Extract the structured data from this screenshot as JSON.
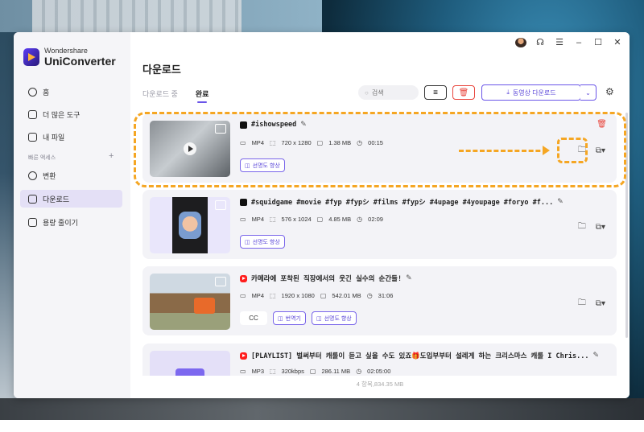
{
  "app": {
    "brand": "Wondershare",
    "product": "UniConverter"
  },
  "sidebar": {
    "items": [
      {
        "label": "홈",
        "icon": "home-icon"
      },
      {
        "label": "더 많은 도구",
        "icon": "toolbox-icon"
      },
      {
        "label": "내 파일",
        "icon": "file-icon"
      }
    ],
    "section_label": "빠른 액세스",
    "quick": [
      {
        "label": "변환",
        "icon": "convert-icon"
      },
      {
        "label": "다운로드",
        "icon": "download-icon",
        "active": true
      },
      {
        "label": "용량 줄이기",
        "icon": "compress-icon"
      }
    ]
  },
  "main": {
    "title": "다운로드",
    "tabs": [
      "다운로드 중",
      "완료"
    ],
    "active_tab": "완료",
    "search_placeholder": "검색",
    "download_button": "동영상 다운로드"
  },
  "downloads": [
    {
      "platform": "tiktok",
      "title": "#ishowspeed",
      "format": "MP4",
      "resolution": "720 x 1280",
      "size": "1.38 MB",
      "duration": "00:15",
      "chips": [
        "선명도 향상"
      ]
    },
    {
      "platform": "tiktok",
      "title": "#squidgame #movie #fyp #fypシ #films #fypシ #4upage #4youpage #foryo #f...",
      "format": "MP4",
      "resolution": "576 x 1024",
      "size": "4.85 MB",
      "duration": "02:09",
      "chips": [
        "선명도 향상"
      ]
    },
    {
      "platform": "youtube",
      "title": "카메라에 포착된 직장에서의 웃긴 실수의 순간들!",
      "format": "MP4",
      "resolution": "1920 x 1080",
      "size": "542.01 MB",
      "duration": "31:06",
      "cc": "CC",
      "chips": [
        "번역기",
        "선명도 향상"
      ]
    },
    {
      "platform": "youtube",
      "title": "[PLAYLIST] 벌써부터 캐롤이 듣고 싶을 수도 있죠🎁도입부부터 설레게 하는 크리스마스 캐롤 I Chris...",
      "format": "MP3",
      "resolution": "320kbps",
      "size": "286.11 MB",
      "duration": "02:05:00"
    }
  ],
  "footer": "4 항목,834.35 MB",
  "colors": {
    "accent": "#6a55e8",
    "annotation": "#f5a623",
    "danger": "#e8453c"
  }
}
